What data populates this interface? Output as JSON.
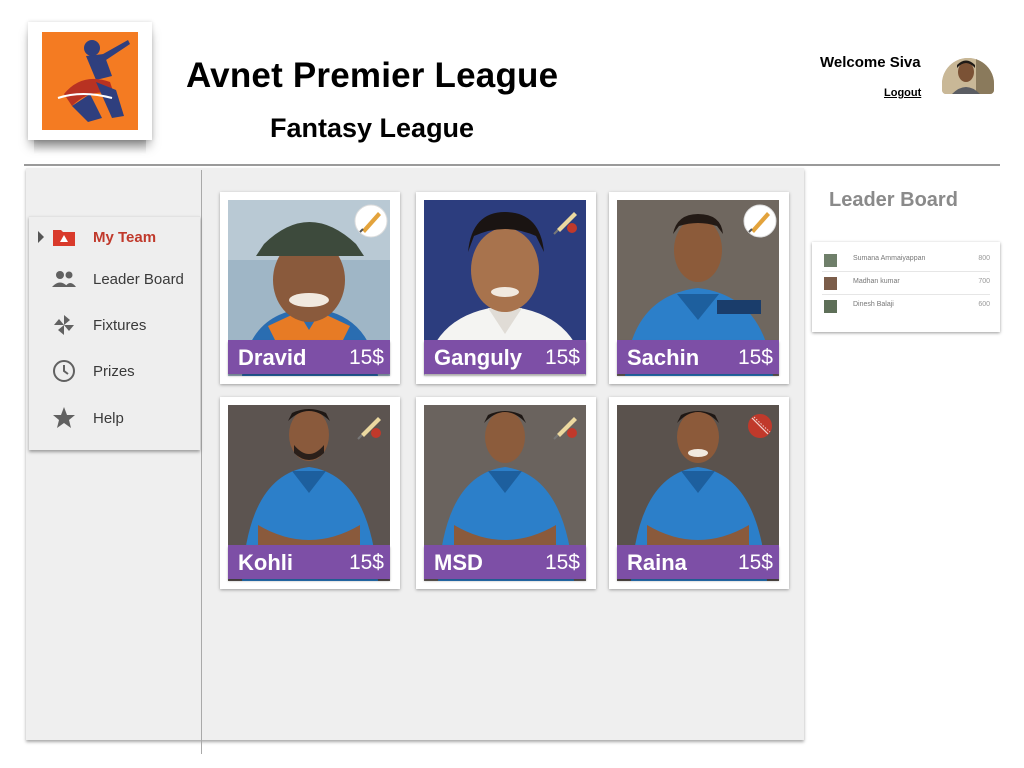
{
  "header": {
    "title": "Avnet Premier League",
    "subtitle": "Fantasy League",
    "welcome": "Welcome Siva",
    "logout": "Logout"
  },
  "sidebar": {
    "items": [
      {
        "label": "My Team",
        "icon": "team-folder-icon",
        "active": true
      },
      {
        "label": "Leader Board",
        "icon": "people-icon",
        "active": false
      },
      {
        "label": "Fixtures",
        "icon": "pinwheel-icon",
        "active": false
      },
      {
        "label": "Prizes",
        "icon": "clock-icon",
        "active": false
      },
      {
        "label": "Help",
        "icon": "star-icon",
        "active": false
      }
    ]
  },
  "players": [
    {
      "name": "Dravid",
      "price": "15$",
      "role_icon": "bat-icon"
    },
    {
      "name": "Ganguly",
      "price": "15$",
      "role_icon": "bat-ball-icon"
    },
    {
      "name": "Sachin",
      "price": "15$",
      "role_icon": "bat-icon"
    },
    {
      "name": "Kohli",
      "price": "15$",
      "role_icon": "bat-ball-icon"
    },
    {
      "name": "MSD",
      "price": "15$",
      "role_icon": "bat-ball-icon"
    },
    {
      "name": "Raina",
      "price": "15$",
      "role_icon": "ball-icon"
    }
  ],
  "leaderboard": {
    "title": "Leader Board",
    "rows": [
      {
        "name": "Sumana Ammaiyappan",
        "score": "800"
      },
      {
        "name": "Madhan kumar",
        "score": "700"
      },
      {
        "name": "Dinesh Balaji",
        "score": "600"
      }
    ]
  },
  "colors": {
    "accent_purple": "#7d4fa6",
    "active_red": "#c0392b",
    "logo_orange": "#f47b22",
    "jersey_blue": "#2c7fc9"
  }
}
